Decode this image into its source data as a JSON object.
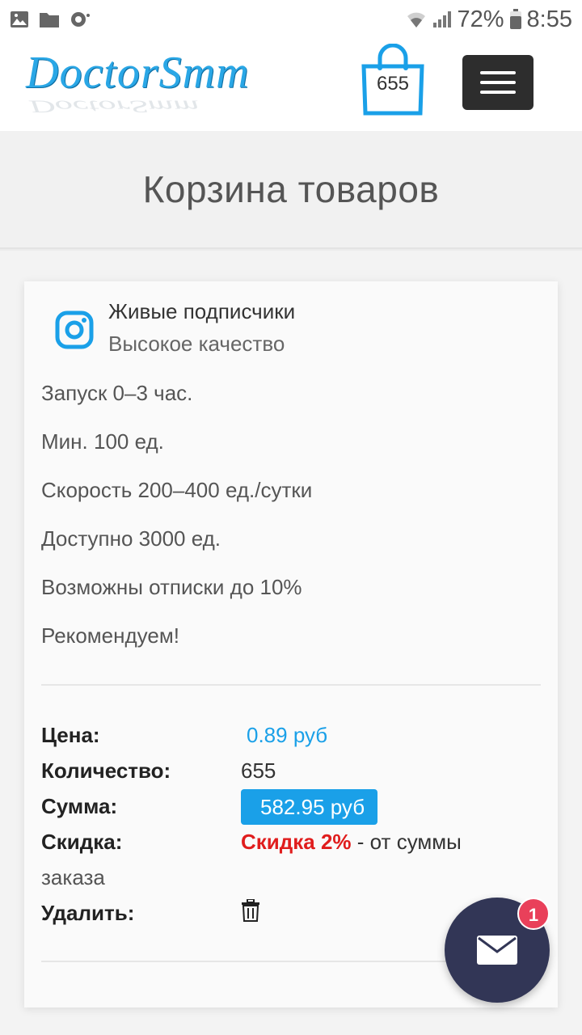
{
  "status_bar": {
    "battery": "72%",
    "time": "8:55",
    "icons": [
      "gallery-icon",
      "folder-icon",
      "sync-icon",
      "wifi-icon",
      "signal-icon",
      "battery-icon"
    ]
  },
  "header": {
    "logo_text": "DoctorSmm",
    "cart_count": "655",
    "icons": [
      "shopping-bag-icon",
      "hamburger-menu-icon"
    ],
    "accent": "#2aa7e6"
  },
  "page": {
    "title": "Корзина товаров"
  },
  "product": {
    "icon": "instagram-icon",
    "name": "Живые подписчики",
    "quality": "Высокое качество",
    "features": [
      "Запуск 0–3 час.",
      "Мин. 100 ед.",
      "Скорость 200–400 ед./сутки",
      "Доступно 3000 ед.",
      "Возможны отписки до 10%",
      "Рекомендуем!"
    ]
  },
  "details": {
    "price_label": "Цена:",
    "price_value": "0.89 руб",
    "quantity_label": "Количество:",
    "quantity_value": "655",
    "sum_label": "Сумма:",
    "sum_value": "582.95 руб",
    "discount_label": "Скидка:",
    "discount_value": "Скидка 2%",
    "discount_suffix": " - от суммы",
    "discount_wrap": "заказа",
    "delete_label": "Удалить:",
    "delete_icon": "trash-icon"
  },
  "chat": {
    "icon": "mail-icon",
    "badge": "1",
    "colors": {
      "button": "#323656",
      "badge": "#e9405a"
    }
  }
}
